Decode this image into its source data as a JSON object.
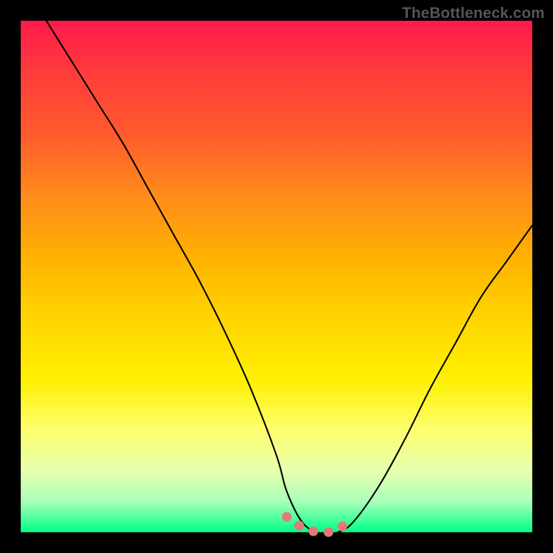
{
  "watermark": "TheBottleneck.com",
  "colors": {
    "gradient_top": "#ff1a4d",
    "gradient_bottom": "#00ff88",
    "curve": "#000000",
    "dots": "#e07b78",
    "frame": "#000000"
  },
  "chart_data": {
    "type": "line",
    "title": "",
    "xlabel": "",
    "ylabel": "",
    "xlim": [
      0,
      100
    ],
    "ylim": [
      0,
      100
    ],
    "annotations": [
      {
        "text": "TheBottleneck.com",
        "position": "top-right"
      }
    ],
    "series": [
      {
        "name": "bottleneck-curve",
        "x": [
          5,
          10,
          15,
          20,
          25,
          30,
          35,
          40,
          45,
          50,
          52,
          55,
          58,
          60,
          62,
          65,
          70,
          75,
          80,
          85,
          90,
          95,
          100
        ],
        "values": [
          100,
          92,
          84,
          76,
          67,
          58,
          49,
          39,
          28,
          15,
          8,
          2,
          0,
          0,
          0,
          2,
          9,
          18,
          28,
          37,
          46,
          53,
          60
        ]
      },
      {
        "name": "optimal-range-dots",
        "x": [
          52,
          54,
          56,
          58,
          60,
          62,
          64
        ],
        "values": [
          3,
          1.5,
          0.5,
          0,
          0,
          0.5,
          2
        ]
      }
    ]
  }
}
